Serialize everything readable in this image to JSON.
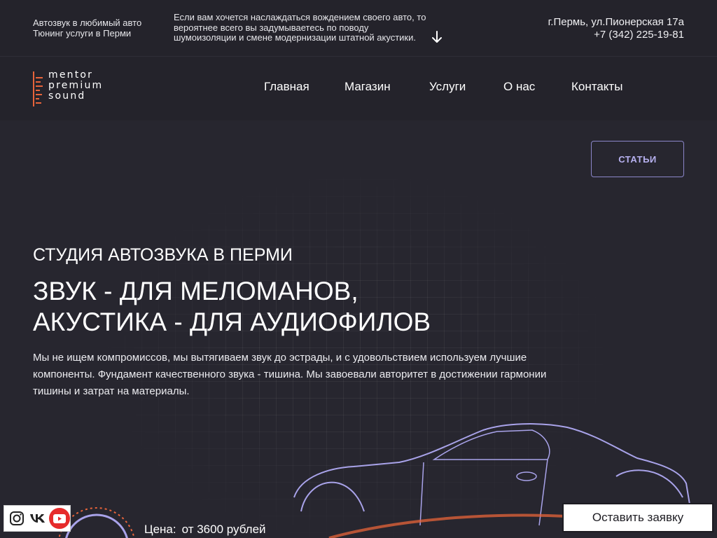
{
  "topbar": {
    "tagline": [
      "Автозвук в любимый авто",
      "Тюнинг услуги в Перми"
    ],
    "promo": [
      "Если вам хочется наслаждаться вождением своего авто, то",
      "вероятнее всего вы задумываетесь по поводу",
      "шумоизоляции и смене модернизации штатной акустики."
    ],
    "address": "г.Пермь, ул.Пионерская 17а",
    "phone": "+7 (342) 225-19-81"
  },
  "logo": {
    "lines": [
      "mentor",
      "premium",
      "sound"
    ]
  },
  "nav": {
    "items": [
      "Главная",
      "Магазин",
      "Услуги",
      "О нас",
      "Контакты"
    ]
  },
  "hero": {
    "articles_label": "СТАТЬИ",
    "subtitle": "СТУДИЯ АВТОЗВУКА В ПЕРМИ",
    "title": [
      "ЗВУК - ДЛЯ МЕЛОМАНОВ,",
      "АКУСТИКА - ДЛЯ АУДИОФИЛОВ"
    ],
    "description": [
      "Мы не ищем компромиссов, мы вытягиваем звук до эстрады, и с удовольствием используем лучшие",
      "компоненты. Фундамент качественного звука - тишина. Мы завоевали авторитет в достижении гармонии",
      "тишины и затрат на материалы."
    ]
  },
  "price": {
    "label": "Цена:",
    "value": "от 3600 рублей"
  },
  "floating": {
    "request_label": "Оставить заявку"
  },
  "social": {
    "icons": [
      "instagram-icon",
      "vk-icon",
      "youtube-icon"
    ]
  },
  "colors": {
    "bg": "#27262f",
    "bar": "#24232b",
    "accent": "#b7b1f0",
    "logo_accent": "#e8643a",
    "youtube": "#e62b2b"
  }
}
